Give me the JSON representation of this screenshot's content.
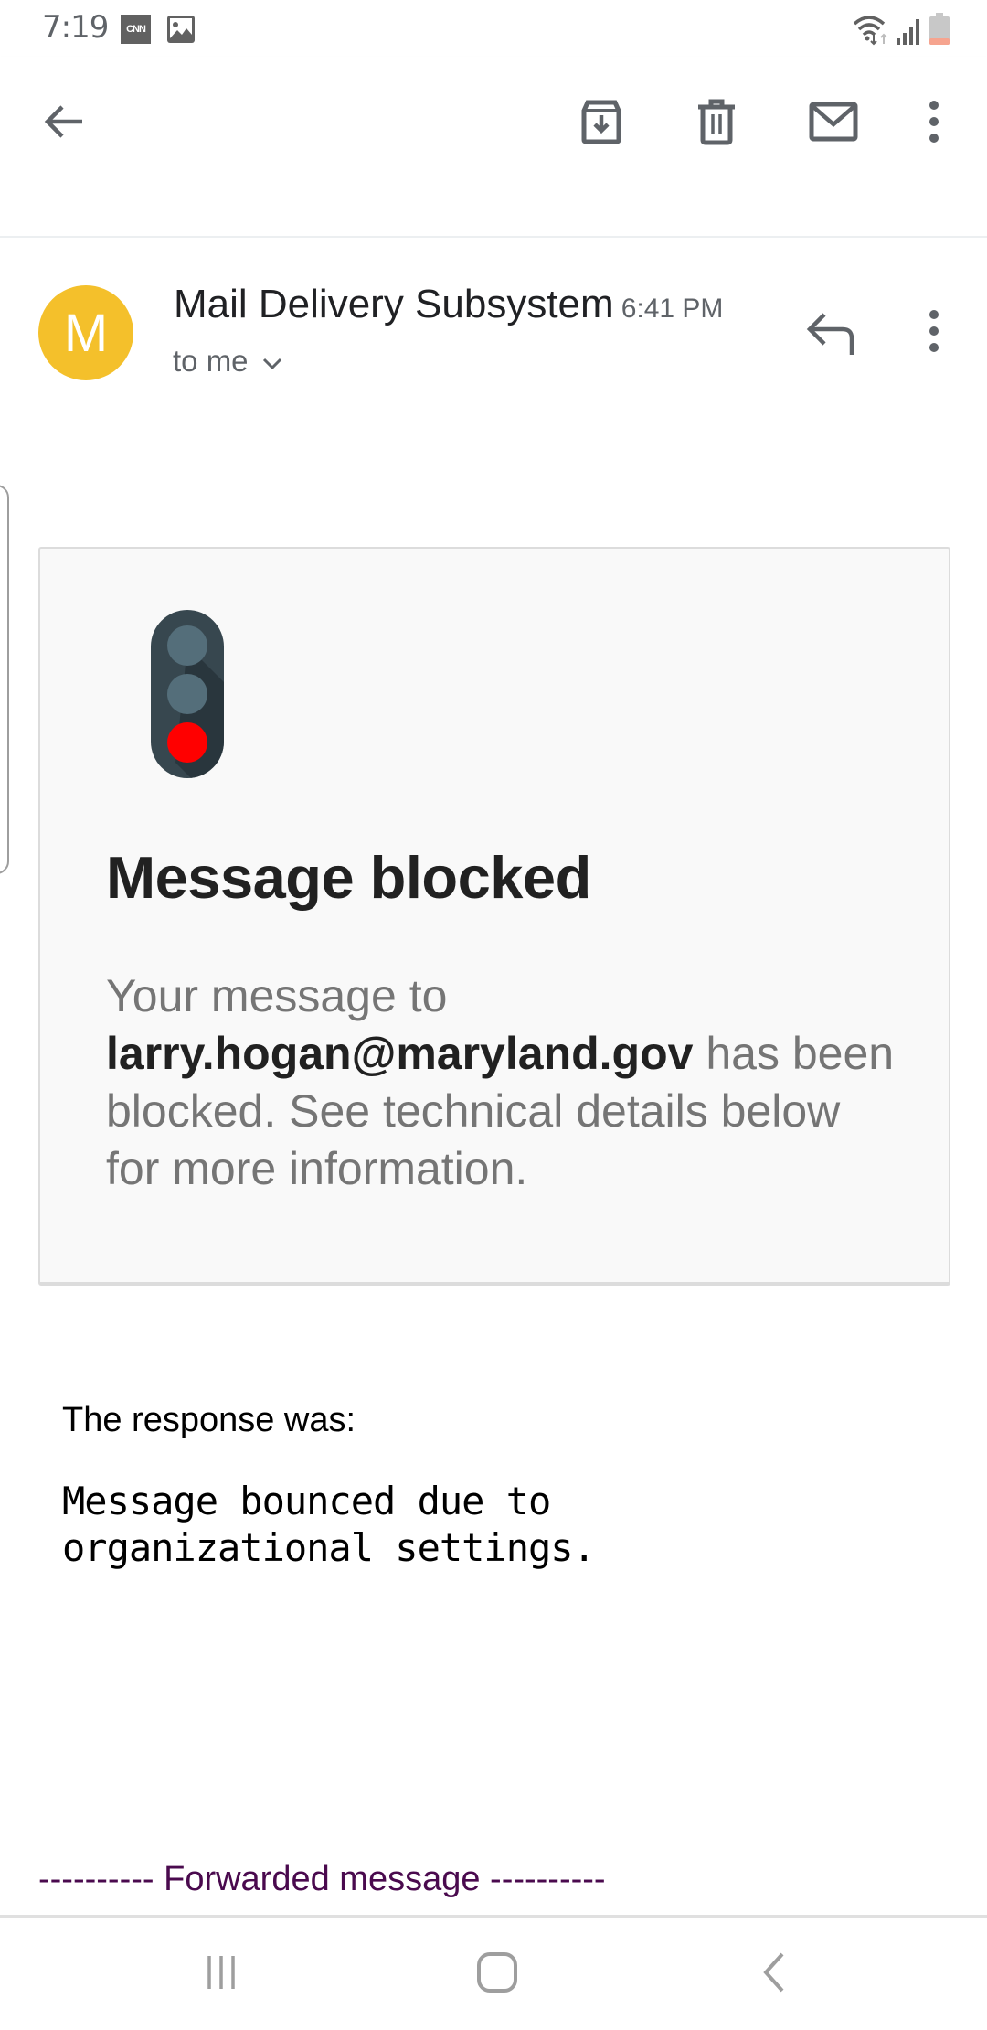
{
  "status_bar": {
    "time": "7:19",
    "notification_icons": [
      "cnn-icon",
      "gallery-icon"
    ],
    "cnn_label": "CNN",
    "system_icons": [
      "wifi-icon",
      "signal-icon",
      "battery-low-icon"
    ],
    "battery_color": "#f6a48f"
  },
  "app_bar": {
    "actions": [
      "back-icon",
      "archive-icon",
      "delete-icon",
      "mark-unread-icon",
      "more-vert-icon"
    ]
  },
  "message": {
    "avatar_letter": "M",
    "avatar_color": "#f4c02b",
    "sender": "Mail Delivery Subsystem",
    "time": "6:41 PM",
    "recipient": "to me"
  },
  "card": {
    "title": "Message blocked",
    "body_prefix": "Your message to",
    "email": "larry.hogan@maryland.gov",
    "body_suffix": "has been blocked. See technical details below for more information.",
    "signal_colors": {
      "off": "#546e7a",
      "red": "#ff0000",
      "housing": "#37474f"
    }
  },
  "response": {
    "label": "The response was:",
    "text": "Message bounced due to\norganizational settings."
  },
  "forwarded": {
    "header": "---------- Forwarded message ----------",
    "color": "#4a0a4e"
  },
  "nav_bar": {
    "buttons": [
      "recents-icon",
      "home-icon",
      "back-nav-icon"
    ]
  }
}
